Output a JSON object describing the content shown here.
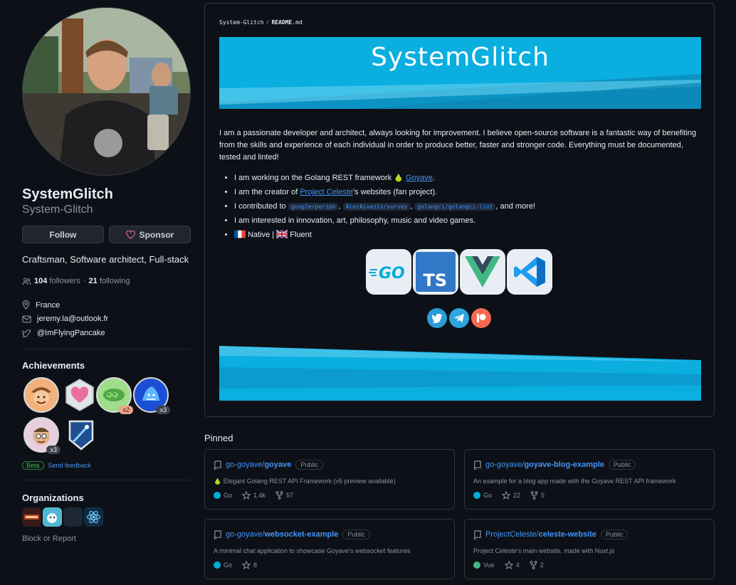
{
  "profile": {
    "display_name": "SystemGlitch",
    "login": "System-Glitch",
    "follow_label": "Follow",
    "sponsor_label": "Sponsor",
    "bio": "Craftsman, Software architect, Full-stack",
    "followers_count": "104",
    "followers_label": "followers",
    "following_count": "21",
    "following_label": "following",
    "location": "France",
    "email": "jeremy.la@outlook.fr",
    "twitter": "@ImFlyingPancake"
  },
  "achievements": {
    "title": "Achievements",
    "badges": [
      {
        "icon": "cowboy-badge-icon",
        "count": ""
      },
      {
        "icon": "heart-badge-icon",
        "count": ""
      },
      {
        "icon": "pair-badge-icon",
        "count": "x2"
      },
      {
        "icon": "shark-badge-icon",
        "count": "x3"
      },
      {
        "icon": "pull-shark-badge-icon",
        "count": "x3"
      },
      {
        "icon": "starstruck-badge-icon",
        "count": ""
      }
    ],
    "beta_label": "Beta",
    "feedback_label": "Send feedback"
  },
  "organizations": {
    "title": "Organizations",
    "block_label": "Block or Report"
  },
  "readme": {
    "path_owner": "System-Glitch",
    "path_sep": "/",
    "path_file": "README",
    "path_ext": ".md",
    "banner_title": "SystemGlitch",
    "intro": "I am a passionate developer and architect, always looking for improvement. I believe open-source software is a fantastic way of benefiting from the skills and experience of each individual in order to produce better, faster and stronger code. Everything must be documented, tested and linted!",
    "b1_text": "I am working on the Golang REST framework ",
    "b1_link": "Goyave",
    "b2_pre": "I am the creator of ",
    "b2_link": "Project Celeste",
    "b2_post": "'s websites (fan project).",
    "b3_pre": "I contributed to ",
    "b3_code1": "google/periph",
    "b3_code2": "AlecAivazis/survey",
    "b3_code3": "golangci/golangci-lint",
    "b3_post": ", and more!",
    "b4_text": "I am interested in innovation, art, philosophy, music and video games.",
    "b5_native": " Native | ",
    "b5_fluent": " Fluent",
    "tech_go": "GO",
    "tech_ts": "TS"
  },
  "pinned": {
    "title": "Pinned",
    "repos": [
      {
        "owner": "go-goyave/",
        "name": "goyave",
        "visibility": "Public",
        "desc": "Elegant Golang REST API Framework (v5 preview available)",
        "lang": "Go",
        "lang_color": "#00add8",
        "stars": "1.4k",
        "forks": "57"
      },
      {
        "owner": "go-goyave/",
        "name": "goyave-blog-example",
        "visibility": "Public",
        "desc": "An example for a blog app made with the Goyave REST API framework",
        "lang": "Go",
        "lang_color": "#00add8",
        "stars": "22",
        "forks": "5"
      },
      {
        "owner": "go-goyave/",
        "name": "websocket-example",
        "visibility": "Public",
        "desc": "A minimal chat application to showcase Goyave's websocket features",
        "lang": "Go",
        "lang_color": "#00add8",
        "stars": "8",
        "forks": ""
      },
      {
        "owner": "ProjectCeleste/",
        "name": "celeste-website",
        "visibility": "Public",
        "desc": "Project Celeste's main website, made with Nuxt.js",
        "lang": "Vue",
        "lang_color": "#41b883",
        "stars": "4",
        "forks": "2"
      }
    ]
  }
}
